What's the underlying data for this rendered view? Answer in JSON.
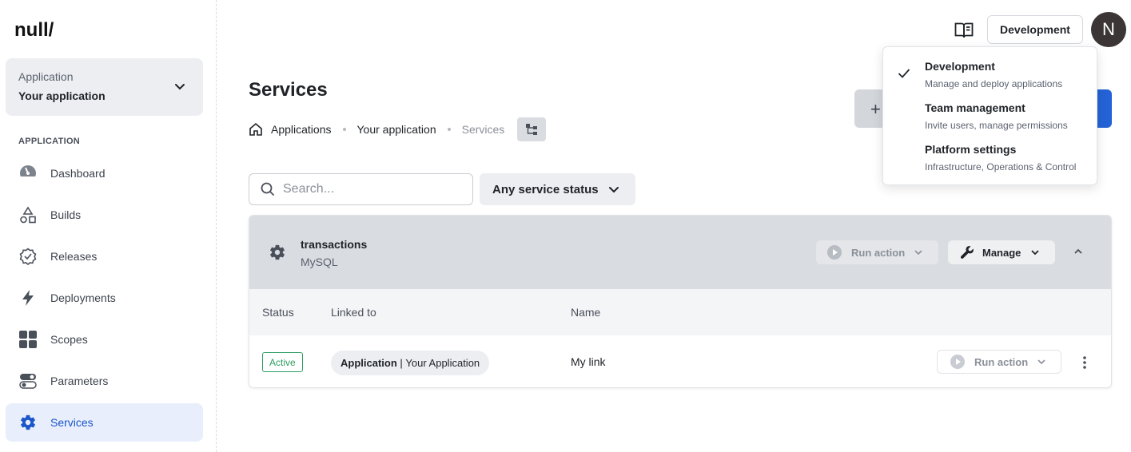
{
  "brand": {
    "logo_text": "null/"
  },
  "sidebar": {
    "app_selector": {
      "label": "Application",
      "value": "Your application"
    },
    "section_label": "APPLICATION",
    "items": [
      {
        "label": "Dashboard",
        "icon": "gauge-icon"
      },
      {
        "label": "Builds",
        "icon": "shapes-icon"
      },
      {
        "label": "Releases",
        "icon": "badge-check-icon"
      },
      {
        "label": "Deployments",
        "icon": "bolt-icon"
      },
      {
        "label": "Scopes",
        "icon": "grid-icon"
      },
      {
        "label": "Parameters",
        "icon": "toggles-icon"
      },
      {
        "label": "Services",
        "icon": "gear-icon",
        "active": true
      }
    ]
  },
  "header": {
    "environment_button": "Development",
    "avatar_initial": "N"
  },
  "environment_menu": {
    "items": [
      {
        "title": "Development",
        "description": "Manage and deploy applications",
        "selected": true
      },
      {
        "title": "Team management",
        "description": "Invite users, manage permissions",
        "selected": false
      },
      {
        "title": "Platform settings",
        "description": "Infrastructure, Operations & Control",
        "selected": false
      }
    ]
  },
  "main": {
    "title": "Services",
    "breadcrumb": [
      "Applications",
      "Your application",
      "Services"
    ],
    "add_button_symbol": "+",
    "search": {
      "placeholder": "Search...",
      "value": ""
    },
    "status_filter": "Any service status",
    "service": {
      "name": "transactions",
      "type": "MySQL",
      "run_action": "Run action",
      "manage": "Manage",
      "columns": [
        "Status",
        "Linked to",
        "Name"
      ],
      "links": [
        {
          "status": "Active",
          "linked_to_kind": "Application",
          "linked_to_separator": " | ",
          "linked_to_name": "Your Application",
          "name": "My link",
          "run_action": "Run action"
        }
      ]
    }
  },
  "colors": {
    "accent": "#2463d6",
    "active_nav_bg": "#e8eefb",
    "status_active": "#2e9d62"
  }
}
